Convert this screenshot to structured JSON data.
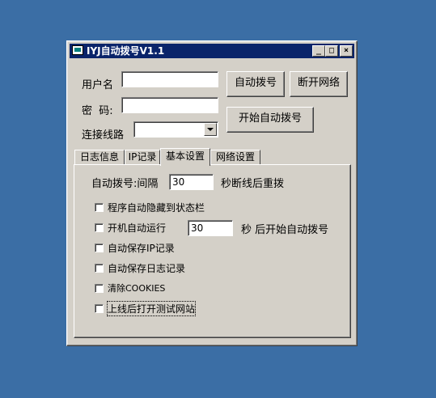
{
  "window": {
    "title": "IYJ自动拨号V1.1",
    "controls": {
      "minimize": "_",
      "maximize": "□",
      "close": "×"
    }
  },
  "form": {
    "username_label": "用户名",
    "username_value": "",
    "password_label": "密  码:",
    "password_value": "",
    "line_label": "连接线路",
    "line_value": ""
  },
  "buttons": {
    "auto_dial": "自动拨号",
    "disconnect": "断开网络",
    "start_auto_dial": "开始自动拨号"
  },
  "tabs": [
    {
      "label": "日志信息"
    },
    {
      "label": "IP记录"
    },
    {
      "label": "基本设置",
      "active": true
    },
    {
      "label": "网络设置"
    }
  ],
  "settings": {
    "redial_prefix": "自动拨号:间隔",
    "redial_value": "30",
    "redial_suffix": "秒断线后重拨",
    "hide_to_tray": {
      "label": "程序自动隐藏到状态栏",
      "checked": false
    },
    "autorun": {
      "label": "开机自动运行",
      "checked": false
    },
    "autorun_delay_value": "30",
    "autorun_suffix": "秒 后开始自动拨号",
    "auto_save_ip": {
      "label": "自动保存IP记录",
      "checked": false
    },
    "auto_save_log": {
      "label": "自动保存日志记录",
      "checked": false
    },
    "clear_cookies": {
      "label": "清除COOKIES",
      "checked": false
    },
    "open_test_site": {
      "label": "上线后打开测试网站",
      "checked": false
    }
  },
  "colors": {
    "desktop": "#3b6ea5",
    "titlebar": "#0a246a",
    "face": "#d4d0c8"
  }
}
